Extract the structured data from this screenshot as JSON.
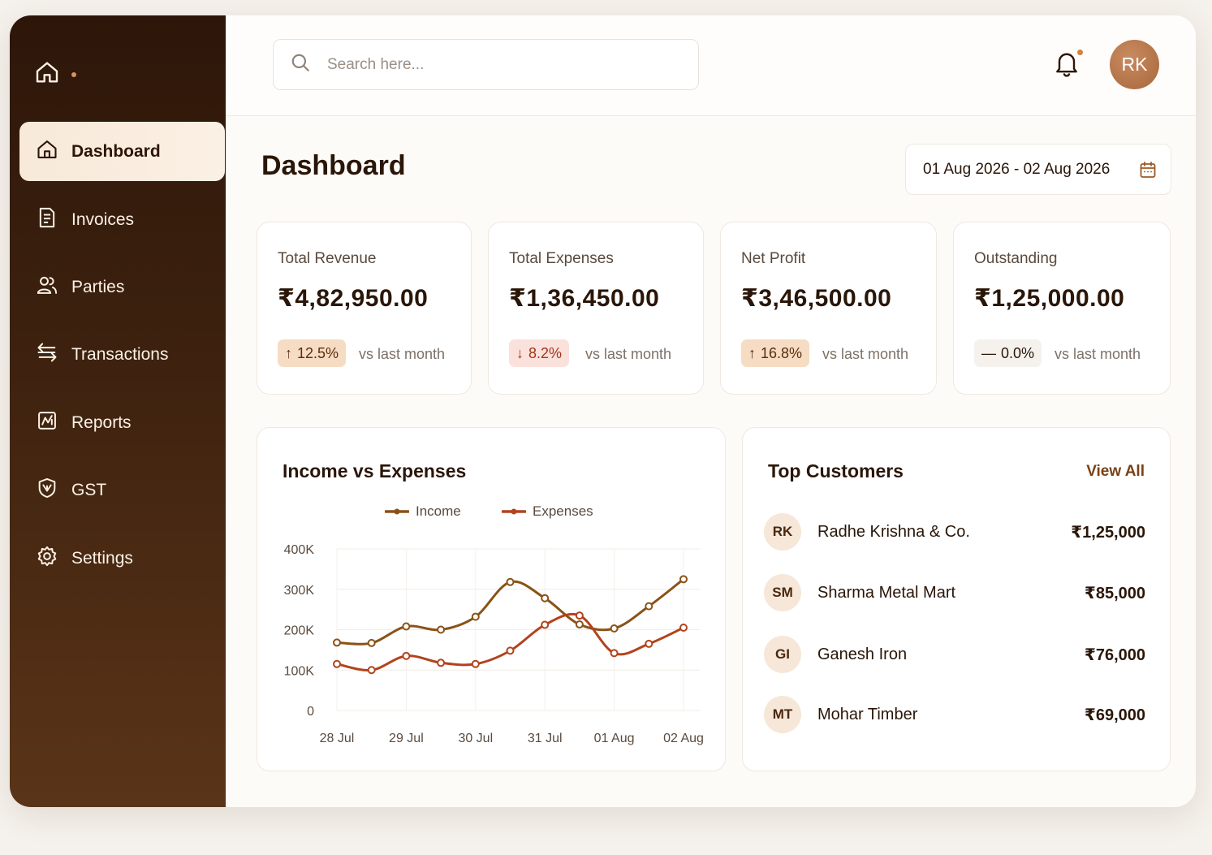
{
  "sidebar": {
    "items": [
      {
        "label": "Dashboard",
        "icon": "home-icon",
        "active": true
      },
      {
        "label": "Invoices",
        "icon": "invoice-icon"
      },
      {
        "label": "Parties",
        "icon": "users-icon"
      },
      {
        "label": "Transactions",
        "icon": "transfer-icon"
      },
      {
        "label": "Reports",
        "icon": "report-icon"
      },
      {
        "label": "GST",
        "icon": "gst-shield-icon"
      },
      {
        "label": "Settings",
        "icon": "gear-icon"
      }
    ]
  },
  "header": {
    "search_placeholder": "Search here...",
    "avatar_initials": "RK"
  },
  "page": {
    "title": "Dashboard",
    "date_range": "01 Aug 2026 - 02 Aug 2026"
  },
  "stats": [
    {
      "label": "Total Revenue",
      "value": "₹4,82,950.00",
      "change": "12.5%",
      "direction": "up",
      "arrow": "↑",
      "vs": "vs last month"
    },
    {
      "label": "Total Expenses",
      "value": "₹1,36,450.00",
      "change": "8.2%",
      "direction": "down",
      "arrow": "↓",
      "vs": "vs last month"
    },
    {
      "label": "Net Profit",
      "value": "₹3,46,500.00",
      "change": "16.8%",
      "direction": "up",
      "arrow": "↑",
      "vs": "vs last month"
    },
    {
      "label": "Outstanding",
      "value": "₹1,25,000.00",
      "change": "0.0%",
      "direction": "flat",
      "arrow": "—",
      "vs": "vs last month"
    }
  ],
  "income_chart": {
    "title": "Income vs Expenses"
  },
  "chart_data": {
    "type": "line",
    "title": "Income vs Expenses",
    "x": [
      0,
      0.5,
      1,
      1.5,
      2,
      2.5,
      3,
      3.5,
      4,
      4.5,
      5
    ],
    "x_tick_labels": [
      "28 Jul",
      "29 Jul",
      "30 Jul",
      "31 Jul",
      "01 Aug",
      "02 Aug"
    ],
    "ylim": [
      0,
      400000
    ],
    "y_tick_labels": [
      "400K",
      "300K",
      "200K",
      "100K",
      "0"
    ],
    "y_ticks": [
      400000,
      300000,
      200000,
      100000,
      0
    ],
    "grid": true,
    "legend_position": "top",
    "series": [
      {
        "name": "Income",
        "color": "#8a5217",
        "values": [
          168000,
          167000,
          208000,
          200000,
          232000,
          318000,
          278000,
          213000,
          203000,
          258000,
          325000
        ]
      },
      {
        "name": "Expenses",
        "color": "#b2431d",
        "values": [
          115000,
          100000,
          135000,
          118000,
          115000,
          148000,
          212000,
          235000,
          142000,
          165000,
          205000
        ]
      }
    ]
  },
  "customers": {
    "title": "Top Customers",
    "view_all": "View All",
    "items": [
      {
        "initials": "RK",
        "name": "Radhe Krishna & Co.",
        "amount": "₹1,25,000"
      },
      {
        "initials": "SM",
        "name": "Sharma Metal Mart",
        "amount": "₹85,000"
      },
      {
        "initials": "GI",
        "name": "Ganesh Iron",
        "amount": "₹76,000"
      },
      {
        "initials": "MT",
        "name": "Mohar Timber",
        "amount": "₹69,000"
      }
    ]
  }
}
